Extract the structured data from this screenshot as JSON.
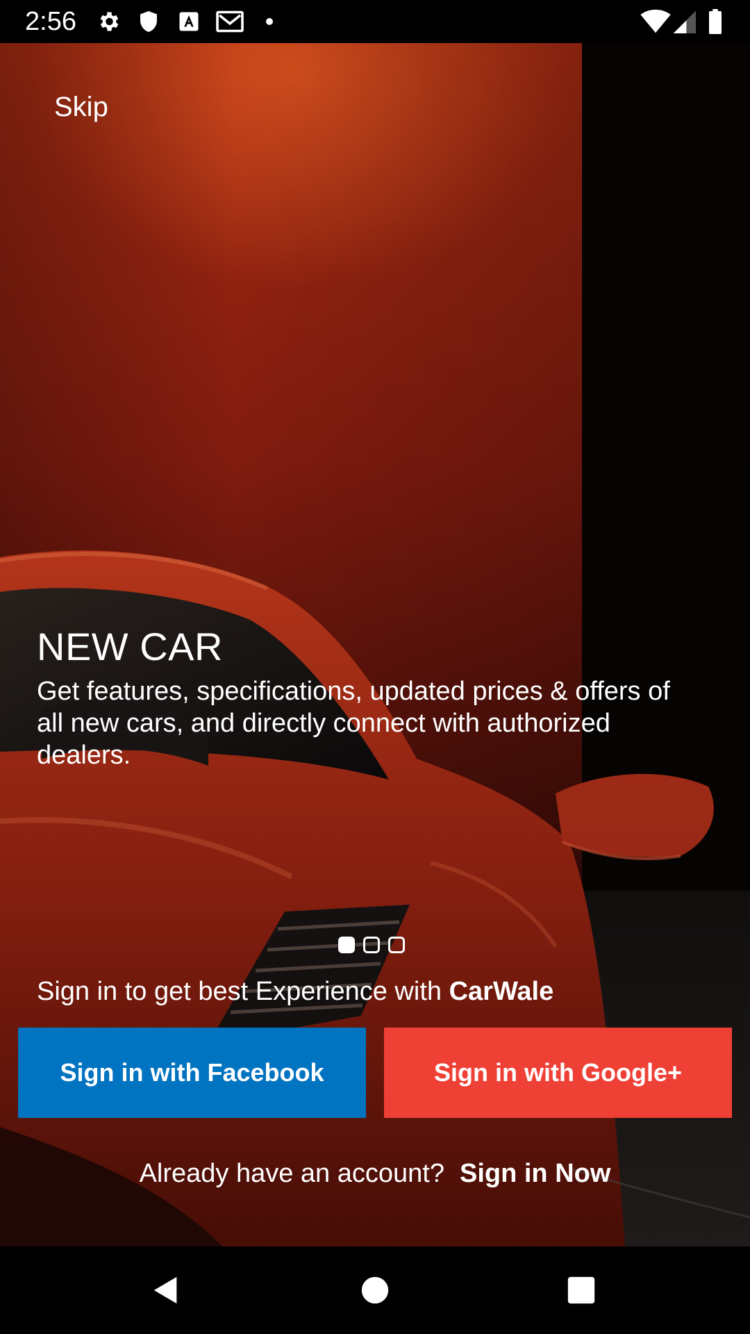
{
  "status_bar": {
    "time": "2:56",
    "icons": [
      "gear-icon",
      "shield-icon",
      "font-a-icon",
      "gmail-icon",
      "dot-icon",
      "wifi-icon",
      "signal-icon",
      "battery-icon"
    ]
  },
  "onboarding": {
    "skip_label": "Skip",
    "title": "NEW CAR",
    "description": "Get features, specifications, updated prices & offers of all new cars, and directly connect with authorized dealers.",
    "pages": {
      "count": 3,
      "current": 1
    }
  },
  "signin": {
    "prompt_prefix": "Sign in to get best Experience with ",
    "prompt_brand": "CarWale",
    "facebook_label": "Sign in with Facebook",
    "google_label": "Sign in with Google+",
    "account_question": "Already have an account?",
    "signin_now_label": "Sign in Now"
  },
  "colors": {
    "facebook": "#0073c1",
    "google": "#ef4036",
    "background": "#000000"
  },
  "nav_bar": {
    "icons": [
      "back-icon",
      "home-icon",
      "recents-icon"
    ]
  }
}
